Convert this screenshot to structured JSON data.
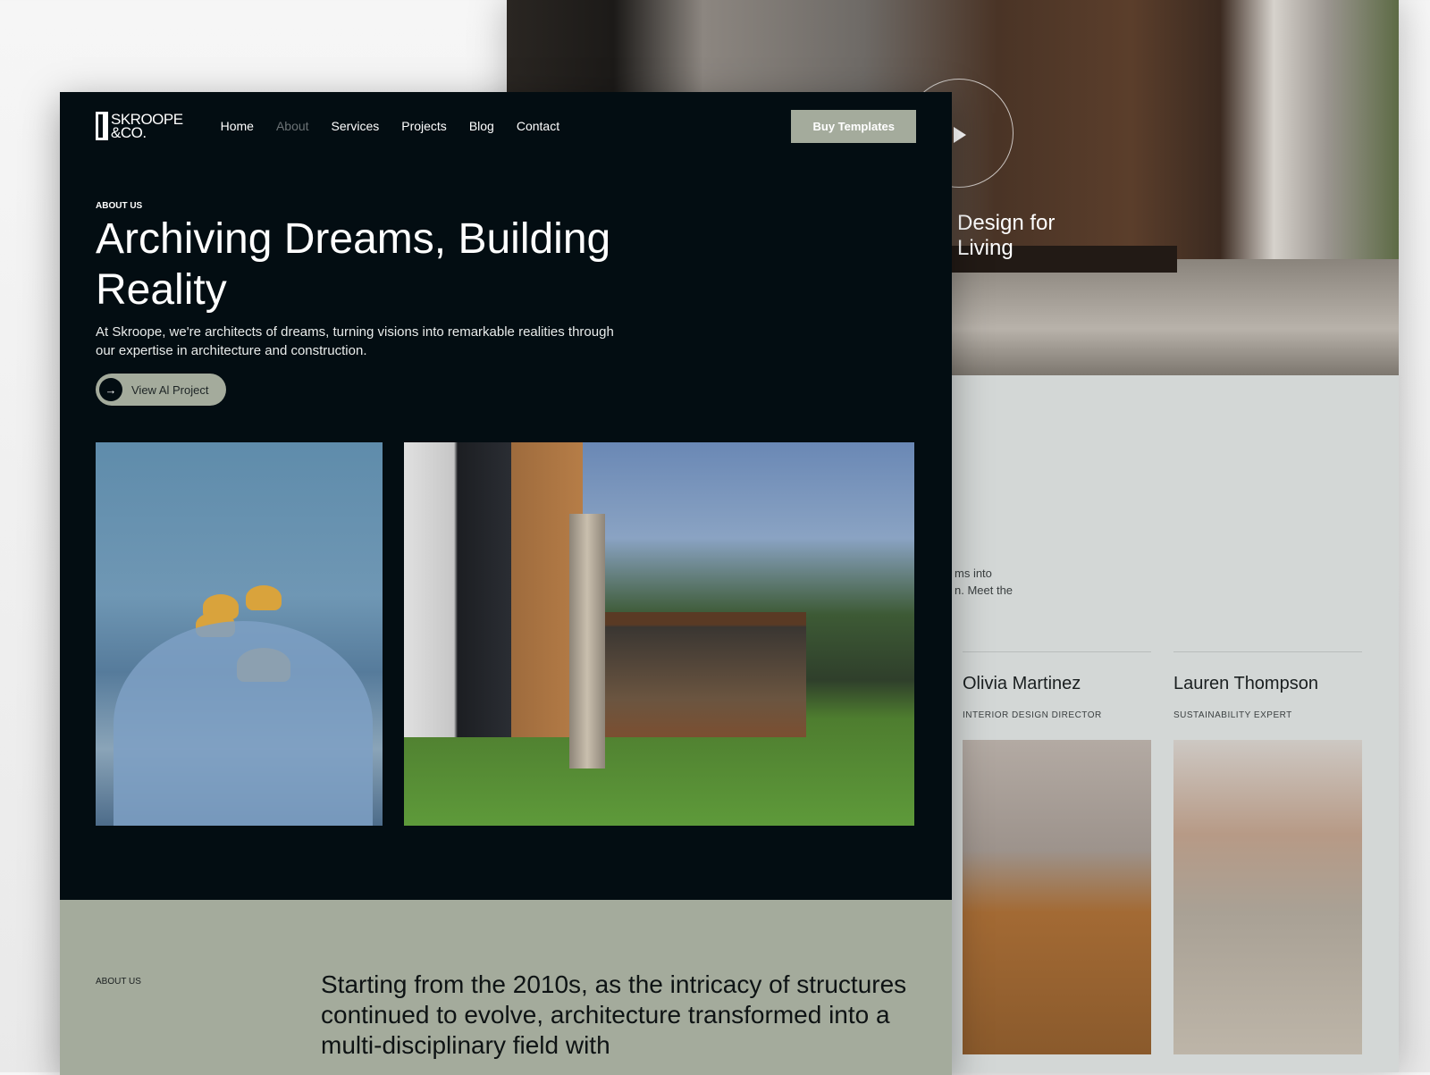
{
  "back_page": {
    "hero_title": "Design for\nLiving",
    "intro_fragment": "ms into\nn. Meet the",
    "team": [
      {
        "name": "Olivia Martinez",
        "role": "INTERIOR DESIGN DIRECTOR"
      },
      {
        "name": "Lauren Thompson",
        "role": "SUSTAINABILITY EXPERT"
      }
    ]
  },
  "front_page": {
    "logo": "SKROOPE\n&CO.",
    "nav": [
      {
        "label": "Home",
        "active": false
      },
      {
        "label": "About",
        "active": true
      },
      {
        "label": "Services",
        "active": false
      },
      {
        "label": "Projects",
        "active": false
      },
      {
        "label": "Blog",
        "active": false
      },
      {
        "label": "Contact",
        "active": false
      }
    ],
    "buy_label": "Buy Templates",
    "eyebrow": "ABOUT US",
    "title": "Archiving Dreams, Building Reality",
    "lead": "At Skroope, we're architects of dreams, turning visions into remarkable realities through our expertise in architecture and construction.",
    "cta_label": "View Al Project",
    "about": {
      "eyebrow": "ABOUT US",
      "text": "Starting from the 2010s, as the intricacy of structures continued to evolve, architecture transformed into a multi-disciplinary field with"
    }
  },
  "colors": {
    "dark": "#030d12",
    "sage": "#a4ab9c",
    "light": "#d3d7d6"
  }
}
